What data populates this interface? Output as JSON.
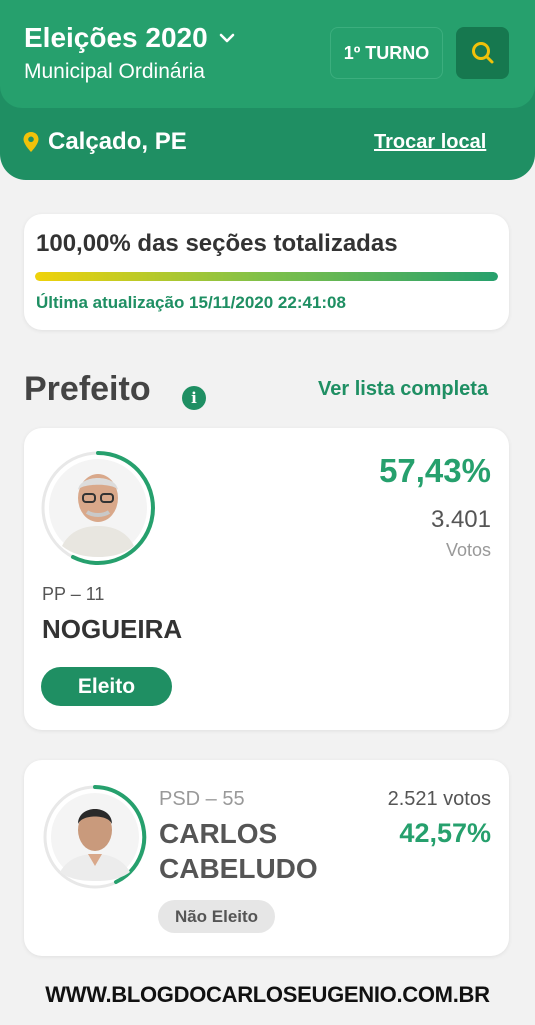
{
  "header": {
    "title": "Eleições 2020",
    "subtitle": "Municipal Ordinária",
    "turno_label": "1º TURNO",
    "location": "Calçado, PE",
    "change_location": "Trocar local"
  },
  "status": {
    "title": "100,00% das seções totalizadas",
    "progress_percent": 100,
    "last_update": "Última atualização 15/11/2020 22:41:08"
  },
  "section": {
    "title": "Prefeito",
    "info_icon": "i",
    "see_full_list": "Ver lista completa"
  },
  "candidates": [
    {
      "party": "PP – 11",
      "name": "NOGUEIRA",
      "percent": "57,43%",
      "percent_value": 57.43,
      "votes": "3.401",
      "votes_label": "Votos",
      "status": "Eleito"
    },
    {
      "party": "PSD – 55",
      "name": "CARLOS CABELUDO",
      "percent": "42,57%",
      "percent_value": 42.57,
      "votes": "2.521 votos",
      "status": "Não Eleito"
    }
  ],
  "footer": "WWW.BLOGDOCARLOSEUGENIO.COM.BR",
  "colors": {
    "brand_green": "#1f8f63",
    "header_green": "#26a06d",
    "accent_yellow": "#f0c20a"
  },
  "icons": {
    "chevron": "chevron-down-icon",
    "search": "search-icon",
    "location": "map-pin-icon",
    "info": "info-icon"
  }
}
